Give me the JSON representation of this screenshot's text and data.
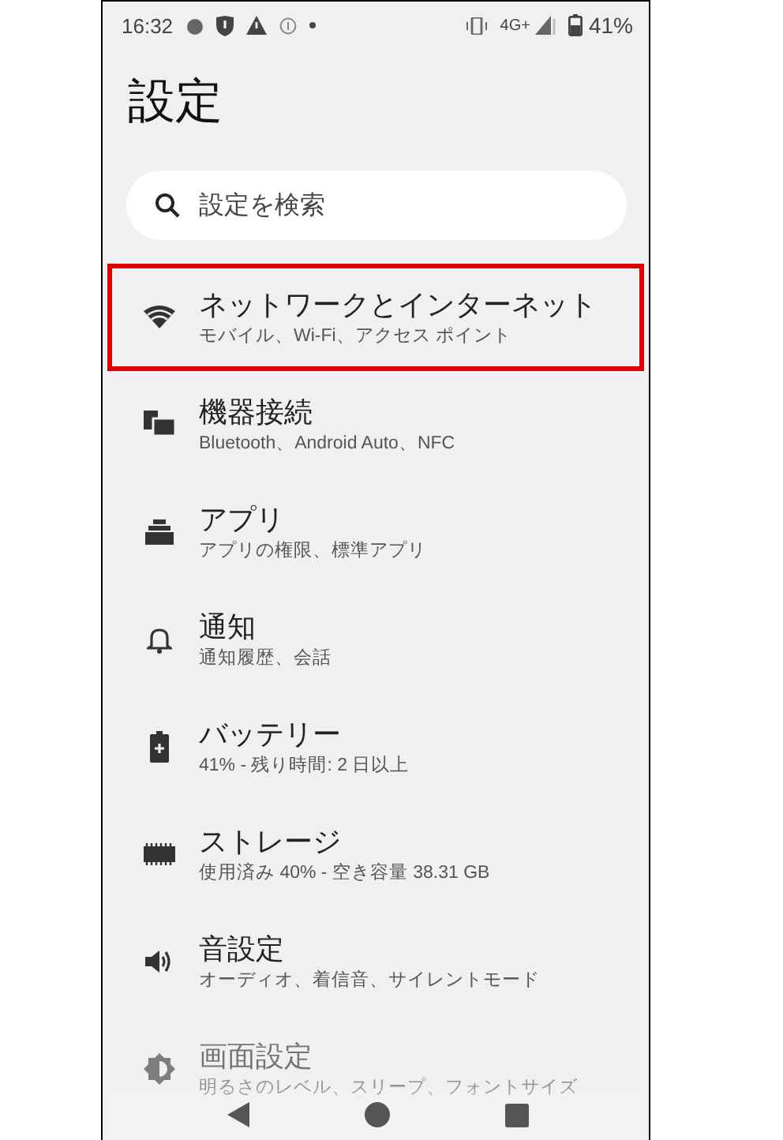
{
  "status_bar": {
    "time": "16:32",
    "network": "4G+",
    "battery": "41%"
  },
  "title": "設定",
  "search": {
    "placeholder": "設定を検索"
  },
  "items": [
    {
      "title": "ネットワークとインターネット",
      "subtitle": "モバイル、Wi-Fi、アクセス ポイント",
      "highlighted": true,
      "faded": false
    },
    {
      "title": "機器接続",
      "subtitle": "Bluetooth、Android Auto、NFC",
      "highlighted": false,
      "faded": false
    },
    {
      "title": "アプリ",
      "subtitle": "アプリの権限、標準アプリ",
      "highlighted": false,
      "faded": false
    },
    {
      "title": "通知",
      "subtitle": "通知履歴、会話",
      "highlighted": false,
      "faded": false
    },
    {
      "title": "バッテリー",
      "subtitle": "41% - 残り時間: 2 日以上",
      "highlighted": false,
      "faded": false
    },
    {
      "title": "ストレージ",
      "subtitle": "使用済み 40% - 空き容量 38.31 GB",
      "highlighted": false,
      "faded": false
    },
    {
      "title": "音設定",
      "subtitle": "オーディオ、着信音、サイレントモード",
      "highlighted": false,
      "faded": false
    },
    {
      "title": "画面設定",
      "subtitle": "明るさのレベル、スリープ、フォントサイズ",
      "highlighted": false,
      "faded": true
    }
  ]
}
